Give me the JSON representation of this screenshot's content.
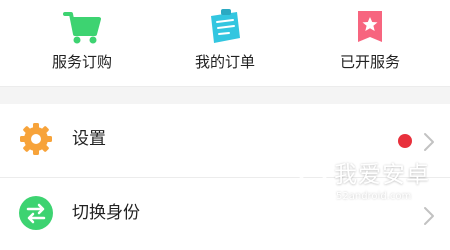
{
  "quick_actions": [
    {
      "label": "服务订购",
      "icon": "shopping-cart-icon",
      "color": "#3dd371"
    },
    {
      "label": "我的订单",
      "icon": "order-clipboard-icon",
      "color": "#33c6e0"
    },
    {
      "label": "已开服务",
      "icon": "service-ticket-icon",
      "color": "#f7657f"
    }
  ],
  "menu": [
    {
      "label": "设置",
      "icon": "gear-icon",
      "color": "#f7a33a",
      "badge_color": "#e8303c"
    },
    {
      "label": "切换身份",
      "icon": "switch-identity-icon",
      "color": "#3dd371"
    }
  ],
  "watermark": {
    "title": "我爱安卓",
    "url": "52android.com"
  }
}
